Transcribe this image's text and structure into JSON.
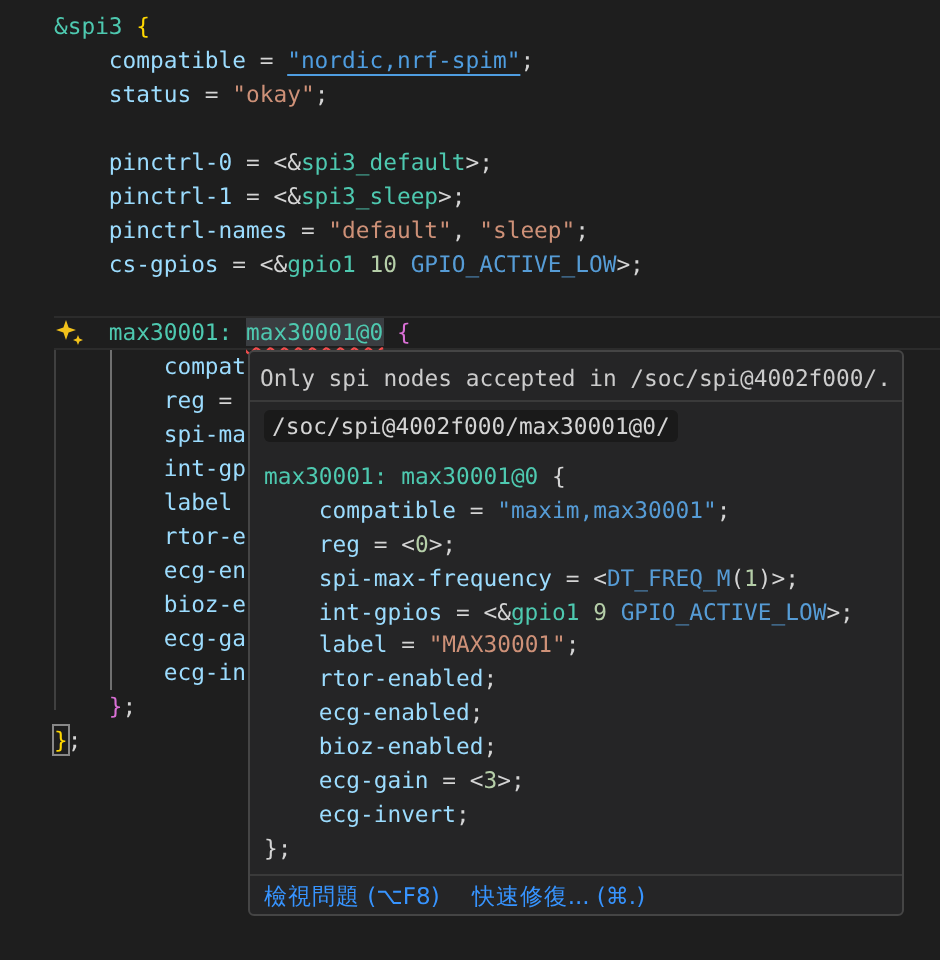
{
  "editor": {
    "lines": [
      {
        "kind": "code",
        "tokens": [
          {
            "text": "&spi3",
            "kind": "label"
          },
          {
            "text": " {",
            "kind": "brace-gold"
          }
        ]
      },
      {
        "kind": "code",
        "tokens": [
          {
            "text": "    compatible",
            "kind": "property"
          },
          {
            "text": " = ",
            "kind": "plain"
          },
          {
            "text": "\"nordic,nrf-spim\"",
            "kind": "link-string"
          },
          {
            "text": ";",
            "kind": "plain"
          }
        ]
      },
      {
        "kind": "code",
        "tokens": [
          {
            "text": "    status",
            "kind": "property"
          },
          {
            "text": " = ",
            "kind": "plain"
          },
          {
            "text": "\"okay\"",
            "kind": "string"
          },
          {
            "text": ";",
            "kind": "plain"
          }
        ]
      },
      {
        "kind": "blank"
      },
      {
        "kind": "code",
        "tokens": [
          {
            "text": "    pinctrl-0",
            "kind": "property"
          },
          {
            "text": " = <&",
            "kind": "plain"
          },
          {
            "text": "spi3_default",
            "kind": "label"
          },
          {
            "text": ">;",
            "kind": "plain"
          }
        ]
      },
      {
        "kind": "code",
        "tokens": [
          {
            "text": "    pinctrl-1",
            "kind": "property"
          },
          {
            "text": " = <&",
            "kind": "plain"
          },
          {
            "text": "spi3_sleep",
            "kind": "label"
          },
          {
            "text": ">;",
            "kind": "plain"
          }
        ]
      },
      {
        "kind": "code",
        "tokens": [
          {
            "text": "    pinctrl-names",
            "kind": "property"
          },
          {
            "text": " = ",
            "kind": "plain"
          },
          {
            "text": "\"default\"",
            "kind": "string"
          },
          {
            "text": ", ",
            "kind": "plain"
          },
          {
            "text": "\"sleep\"",
            "kind": "string"
          },
          {
            "text": ";",
            "kind": "plain"
          }
        ]
      },
      {
        "kind": "code",
        "tokens": [
          {
            "text": "    cs-gpios",
            "kind": "property"
          },
          {
            "text": " = <&",
            "kind": "plain"
          },
          {
            "text": "gpio1",
            "kind": "label"
          },
          {
            "text": " 10",
            "kind": "number"
          },
          {
            "text": " GPIO_ACTIVE_LOW",
            "kind": "macro"
          },
          {
            "text": ">;",
            "kind": "plain"
          }
        ]
      },
      {
        "kind": "blank"
      },
      {
        "kind": "code",
        "current": true,
        "tokens": [
          {
            "text": "    max30001: ",
            "kind": "label"
          },
          {
            "text": "max30001@0",
            "kind": "error-label"
          },
          {
            "text": " {",
            "kind": "brace-pink"
          }
        ]
      },
      {
        "kind": "code",
        "tokens": [
          {
            "text": "        compat",
            "kind": "property"
          }
        ]
      },
      {
        "kind": "code",
        "tokens": [
          {
            "text": "        reg",
            "kind": "property"
          },
          {
            "text": " =",
            "kind": "plain"
          }
        ]
      },
      {
        "kind": "code",
        "tokens": [
          {
            "text": "        spi-ma",
            "kind": "property"
          }
        ]
      },
      {
        "kind": "code",
        "tokens": [
          {
            "text": "        int-gp",
            "kind": "property"
          }
        ]
      },
      {
        "kind": "code",
        "tokens": [
          {
            "text": "        label",
            "kind": "property"
          }
        ]
      },
      {
        "kind": "code",
        "tokens": [
          {
            "text": "        rtor-e",
            "kind": "property"
          }
        ]
      },
      {
        "kind": "code",
        "tokens": [
          {
            "text": "        ecg-en",
            "kind": "property"
          }
        ]
      },
      {
        "kind": "code",
        "tokens": [
          {
            "text": "        bioz-e",
            "kind": "property"
          }
        ]
      },
      {
        "kind": "code",
        "tokens": [
          {
            "text": "        ecg-ga",
            "kind": "property"
          }
        ]
      },
      {
        "kind": "code",
        "tokens": [
          {
            "text": "        ecg-in",
            "kind": "property"
          }
        ]
      },
      {
        "kind": "code",
        "tokens": [
          {
            "text": "    }",
            "kind": "brace-pink"
          },
          {
            "text": ";",
            "kind": "plain"
          }
        ]
      },
      {
        "kind": "code",
        "tokens": [
          {
            "text": "}",
            "kind": "brace-gold-boxed"
          },
          {
            "text": ";",
            "kind": "plain"
          }
        ]
      }
    ]
  },
  "hover": {
    "message": "Only spi nodes accepted in /soc/spi@4002f000/.",
    "path": "/soc/spi@4002f000/max30001@0/",
    "code_lines": [
      {
        "tokens": [
          {
            "text": "max30001:",
            "kind": "label"
          },
          {
            "text": " max30001@0",
            "kind": "label"
          },
          {
            "text": " {",
            "kind": "plain"
          }
        ]
      },
      {
        "tokens": [
          {
            "text": "    compatible",
            "kind": "property"
          },
          {
            "text": " = ",
            "kind": "plain"
          },
          {
            "text": "\"maxim,max30001\"",
            "kind": "macro"
          },
          {
            "text": ";",
            "kind": "plain"
          }
        ]
      },
      {
        "tokens": [
          {
            "text": "    reg",
            "kind": "property"
          },
          {
            "text": " = <",
            "kind": "plain"
          },
          {
            "text": "0",
            "kind": "number"
          },
          {
            "text": ">;",
            "kind": "plain"
          }
        ]
      },
      {
        "tokens": [
          {
            "text": "    spi-max-frequency",
            "kind": "property"
          },
          {
            "text": " = <",
            "kind": "plain"
          },
          {
            "text": "DT_FREQ_M",
            "kind": "macro"
          },
          {
            "text": "(",
            "kind": "plain"
          },
          {
            "text": "1",
            "kind": "number"
          },
          {
            "text": ")>;",
            "kind": "plain"
          }
        ]
      },
      {
        "tokens": [
          {
            "text": "    int-gpios",
            "kind": "property"
          },
          {
            "text": " = <&",
            "kind": "plain"
          },
          {
            "text": "gpio1",
            "kind": "label"
          },
          {
            "text": " 9",
            "kind": "number"
          },
          {
            "text": " GPIO_ACTIVE_LOW",
            "kind": "macro"
          },
          {
            "text": ">;",
            "kind": "plain"
          }
        ]
      },
      {
        "tokens": [
          {
            "text": "    label",
            "kind": "property"
          },
          {
            "text": " = ",
            "kind": "plain"
          },
          {
            "text": "\"MAX30001\"",
            "kind": "string"
          },
          {
            "text": ";",
            "kind": "plain"
          }
        ]
      },
      {
        "tokens": [
          {
            "text": "    rtor-enabled",
            "kind": "property"
          },
          {
            "text": ";",
            "kind": "plain"
          }
        ]
      },
      {
        "tokens": [
          {
            "text": "    ecg-enabled",
            "kind": "property"
          },
          {
            "text": ";",
            "kind": "plain"
          }
        ]
      },
      {
        "tokens": [
          {
            "text": "    bioz-enabled",
            "kind": "property"
          },
          {
            "text": ";",
            "kind": "plain"
          }
        ]
      },
      {
        "tokens": [
          {
            "text": "    ecg-gain",
            "kind": "property"
          },
          {
            "text": " = <",
            "kind": "plain"
          },
          {
            "text": "3",
            "kind": "number"
          },
          {
            "text": ">;",
            "kind": "plain"
          }
        ]
      },
      {
        "tokens": [
          {
            "text": "    ecg-invert",
            "kind": "property"
          },
          {
            "text": ";",
            "kind": "plain"
          }
        ]
      },
      {
        "tokens": [
          {
            "text": "};",
            "kind": "plain"
          }
        ]
      }
    ],
    "actions": [
      "檢視問題 (⌥F8)",
      "快速修復... (⌘.)"
    ]
  }
}
